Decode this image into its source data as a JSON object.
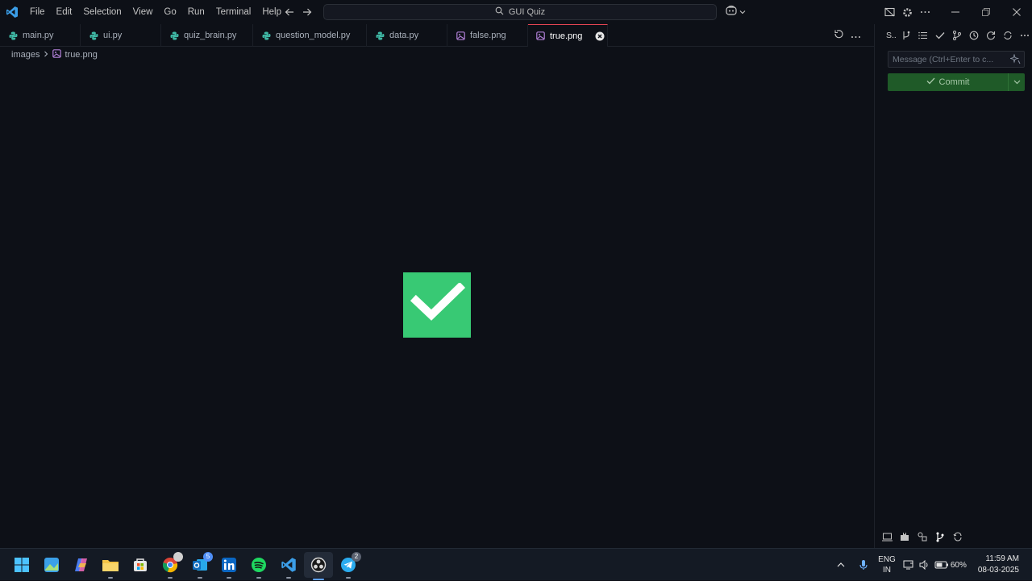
{
  "titlebar": {
    "menu": [
      "File",
      "Edit",
      "Selection",
      "View",
      "Go",
      "Run",
      "Terminal",
      "Help"
    ],
    "search_text": "GUI Quiz"
  },
  "tabs": [
    {
      "label": "main.py",
      "icon": "python-icon"
    },
    {
      "label": "ui.py",
      "icon": "python-icon"
    },
    {
      "label": "quiz_brain.py",
      "icon": "python-icon"
    },
    {
      "label": "question_model.py",
      "icon": "python-icon"
    },
    {
      "label": "data.py",
      "icon": "python-icon"
    },
    {
      "label": "false.png",
      "icon": "image-file-icon"
    },
    {
      "label": "true.png",
      "icon": "image-file-icon",
      "active": true
    }
  ],
  "breadcrumb": {
    "folder": "images",
    "file": "true.png"
  },
  "sidebar": {
    "title": "S..",
    "message_placeholder": "Message (Ctrl+Enter to c...",
    "commit_label": "Commit"
  },
  "taskbar": {
    "language_top": "ENG",
    "language_bottom": "IN",
    "battery": "60%",
    "time": "11:59 AM",
    "date": "08-03-2025",
    "outlook_badge": "5",
    "telegram_badge": "2"
  },
  "colors": {
    "background": "#0d1017",
    "check_green": "#38c974",
    "commit_green": "#1f5a28",
    "active_tab_border": "#e64553"
  }
}
